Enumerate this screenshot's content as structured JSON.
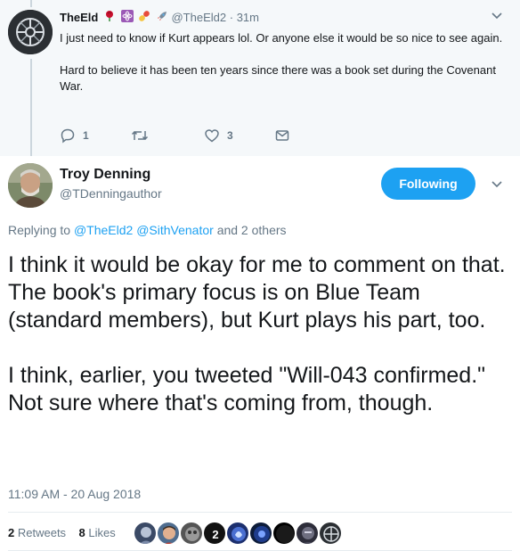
{
  "parent_tweet": {
    "display_name": "TheEld",
    "name_emojis": [
      "rose-emoji",
      "atom-emoji",
      "pill-emoji",
      "rocket-emoji"
    ],
    "handle": "@TheEld2",
    "separator": "·",
    "time": "31m",
    "paragraphs": [
      "I just need to know if Kurt appears lol. Or anyone else it would be so nice to see again.",
      "Hard to believe it has been ten years since there was a book set during the Covenant War."
    ],
    "actions": {
      "reply_count": "1",
      "retweet_count": "",
      "like_count": "3"
    }
  },
  "main_tweet": {
    "display_name": "Troy Denning",
    "handle": "@TDenningauthor",
    "follow_label": "Following",
    "reply_prefix": "Replying to",
    "reply_user1": "@TheEld2",
    "reply_user2": "@SithVenator",
    "reply_suffix": "and 2 others",
    "paragraphs": [
      "I think it would be okay for me to comment on that. The book's primary focus is on Blue Team (standard members), but Kurt plays his part, too.",
      "I think, earlier, you tweeted \"Will-043 confirmed.\" Not sure where that's coming from, though."
    ],
    "timestamp": "11:09 AM - 20 Aug 2018",
    "retweets_count": "2",
    "retweets_label": "Retweets",
    "likes_count": "8",
    "likes_label": "Likes",
    "liker_avatar_count_shown": 9,
    "liker_badge": "2"
  },
  "colors": {
    "accent": "#1da1f2",
    "secondary_text": "#657786",
    "primary_text": "#14171a",
    "parent_background": "#f5f8fa"
  }
}
